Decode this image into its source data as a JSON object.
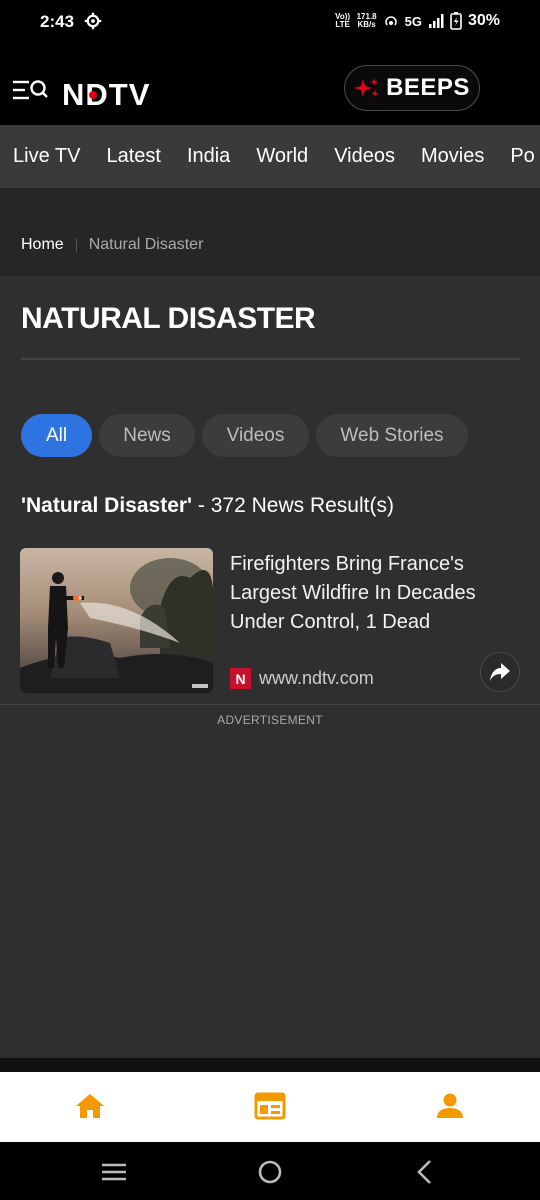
{
  "status_bar": {
    "time": "2:43",
    "volte": "Vo)) LTE",
    "net_speed_value": "171.8",
    "net_speed_unit": "KB/s",
    "network": "5G",
    "battery": "30%"
  },
  "header": {
    "logo_text": "NDTV",
    "beeps_label": "BEEPS"
  },
  "nav": {
    "items": [
      "Live TV",
      "Latest",
      "India",
      "World",
      "Videos",
      "Movies",
      "Po"
    ]
  },
  "breadcrumb": {
    "home": "Home",
    "current": "Natural Disaster"
  },
  "page": {
    "title": "NATURAL DISASTER"
  },
  "filters": {
    "items": [
      "All",
      "News",
      "Videos",
      "Web Stories"
    ],
    "active": "All"
  },
  "results": {
    "query": "'Natural Disaster'",
    "suffix": " - 372 News Result(s)"
  },
  "article": {
    "headline": "Firefighters Bring France's Largest Wildfire In Decades Under Control, 1 Dead",
    "source_badge": "N",
    "source_url": "www.ndtv.com"
  },
  "ad": {
    "label": "ADVERTISEMENT"
  },
  "colors": {
    "accent": "#2d74e0",
    "brand_red": "#e60012",
    "bottom_nav_icon": "#f39a00"
  },
  "icons": {
    "status_settings": "gear-icon",
    "menu": "menu-search-icon",
    "beeps": "sparkle-icon",
    "share": "share-icon",
    "home": "home-icon",
    "news": "newspaper-icon",
    "profile": "person-icon"
  }
}
